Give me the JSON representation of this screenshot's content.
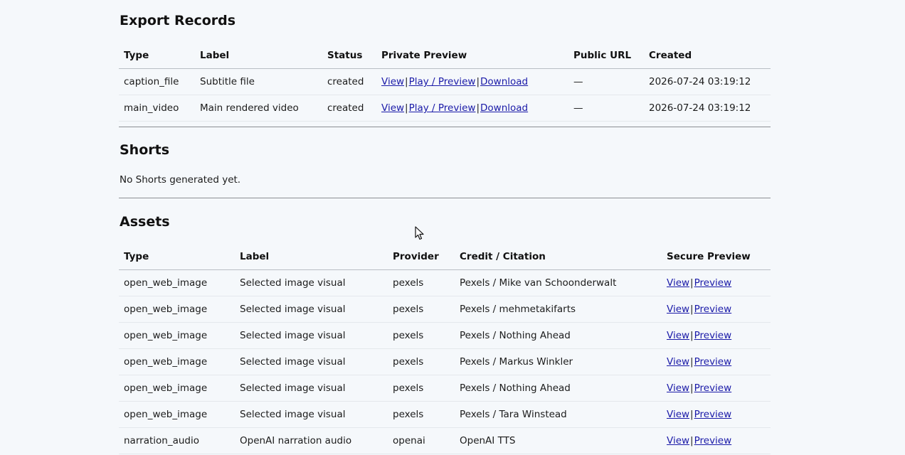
{
  "export_records": {
    "title": "Export Records",
    "columns": [
      "Type",
      "Label",
      "Status",
      "Private Preview",
      "Public URL",
      "Created"
    ],
    "rows": [
      {
        "type": "caption_file",
        "label": "Subtitle file",
        "status": "created",
        "view": "View",
        "play": "Play / Preview",
        "download": "Download",
        "public_url": "—",
        "created": "2026-07-24 03:19:12"
      },
      {
        "type": "main_video",
        "label": "Main rendered video",
        "status": "created",
        "view": "View",
        "play": "Play / Preview",
        "download": "Download",
        "public_url": "—",
        "created": "2026-07-24 03:19:12"
      }
    ]
  },
  "shorts": {
    "title": "Shorts",
    "empty_message": "No Shorts generated yet."
  },
  "assets": {
    "title": "Assets",
    "columns": [
      "Type",
      "Label",
      "Provider",
      "Credit / Citation",
      "Secure Preview"
    ],
    "rows": [
      {
        "type": "open_web_image",
        "label": "Selected image visual",
        "provider": "pexels",
        "credit": "Pexels / Mike van Schoonderwalt",
        "view": "View",
        "preview": "Preview"
      },
      {
        "type": "open_web_image",
        "label": "Selected image visual",
        "provider": "pexels",
        "credit": "Pexels / mehmetakifarts",
        "view": "View",
        "preview": "Preview"
      },
      {
        "type": "open_web_image",
        "label": "Selected image visual",
        "provider": "pexels",
        "credit": "Pexels / Nothing Ahead",
        "view": "View",
        "preview": "Preview"
      },
      {
        "type": "open_web_image",
        "label": "Selected image visual",
        "provider": "pexels",
        "credit": "Pexels / Markus Winkler",
        "view": "View",
        "preview": "Preview"
      },
      {
        "type": "open_web_image",
        "label": "Selected image visual",
        "provider": "pexels",
        "credit": "Pexels / Nothing Ahead",
        "view": "View",
        "preview": "Preview"
      },
      {
        "type": "open_web_image",
        "label": "Selected image visual",
        "provider": "pexels",
        "credit": "Pexels / Tara Winstead",
        "view": "View",
        "preview": "Preview"
      },
      {
        "type": "narration_audio",
        "label": "OpenAI narration audio",
        "provider": "openai",
        "credit": "OpenAI TTS",
        "view": "View",
        "preview": "Preview"
      }
    ]
  },
  "colors": {
    "background": "#f5f8fb",
    "link": "#1a1aa8",
    "text": "#1b1b1b"
  },
  "separator": "|"
}
